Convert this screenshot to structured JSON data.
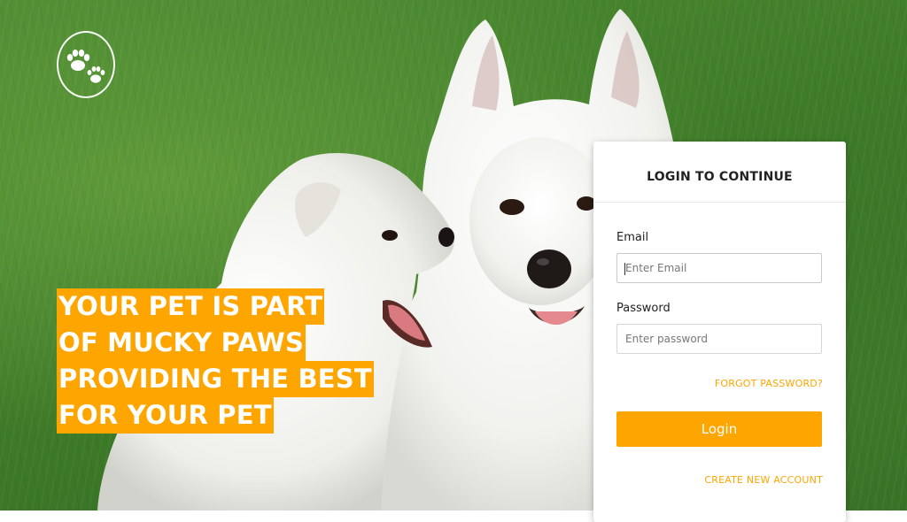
{
  "brand": {
    "logo_icon": "paw-prints-icon"
  },
  "hero": {
    "headline_lines": [
      "YOUR PET IS PART",
      "OF MUCKY PAWS",
      "PROVIDING THE BEST",
      "FOR YOUR PET"
    ],
    "highlight_color": "#ffa500"
  },
  "login": {
    "title": "LOGIN TO CONTINUE",
    "email_label": "Email",
    "email_placeholder": "Enter Email",
    "password_label": "Password",
    "password_placeholder": "Enter password",
    "forgot_link": "FORGOT PASSWORD?",
    "submit_label": "Login",
    "create_account_link": "CREATE NEW ACCOUNT",
    "accent_color": "#ffa500"
  }
}
